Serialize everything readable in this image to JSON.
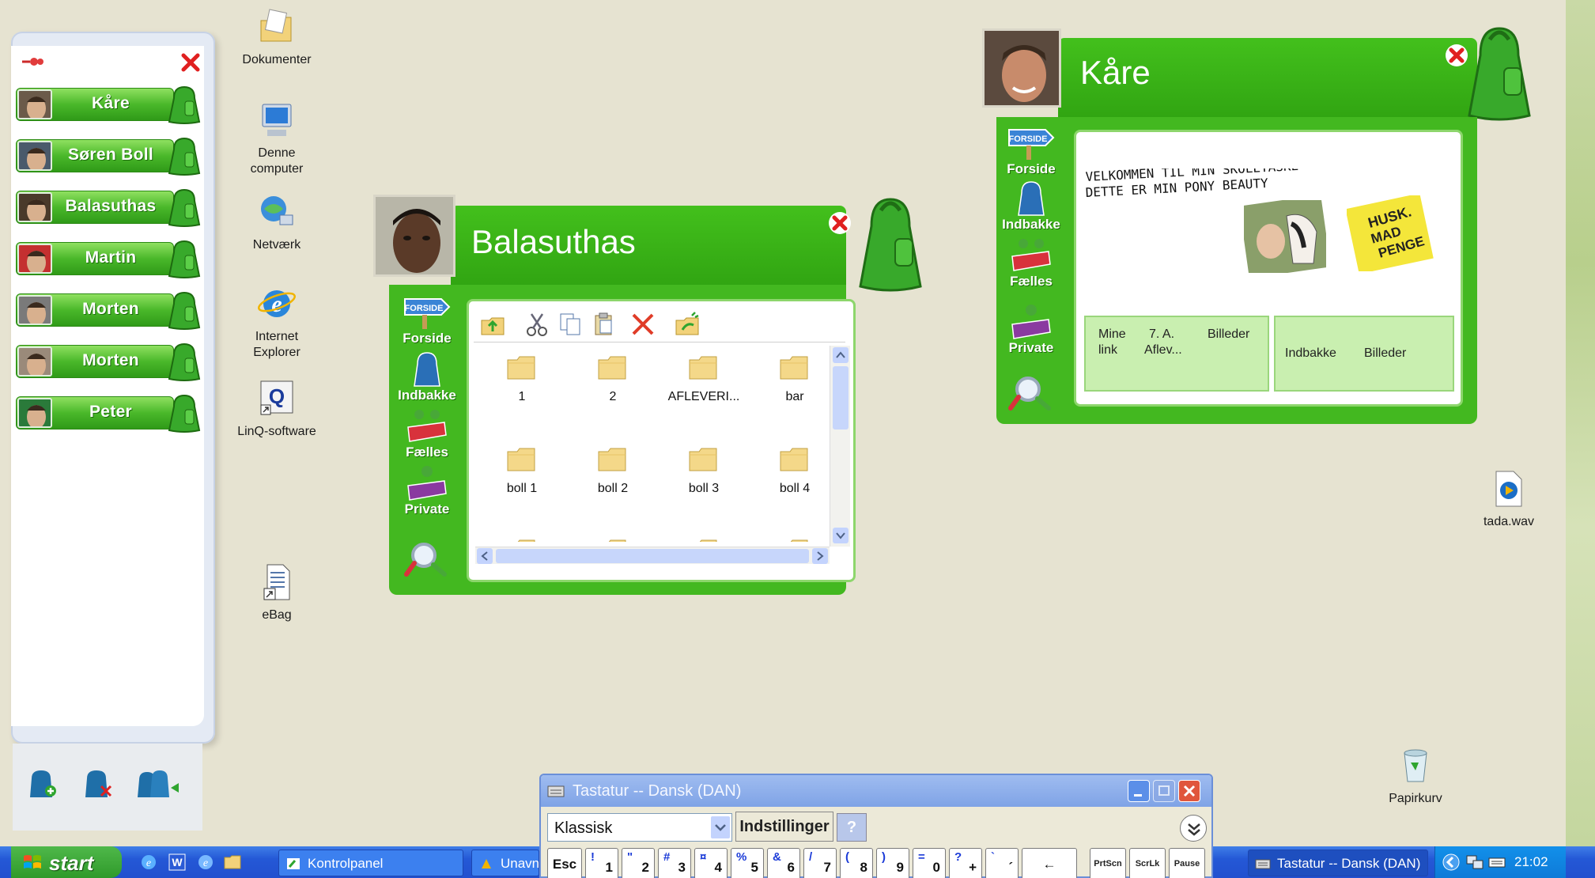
{
  "desktop": {
    "icons": [
      {
        "label": "Dokumenter",
        "icon": "folder-documents-icon"
      },
      {
        "label": "Denne computer",
        "icon": "my-computer-icon"
      },
      {
        "label": "Netværk",
        "icon": "network-icon"
      },
      {
        "label": "Internet Explorer",
        "icon": "internet-explorer-icon"
      },
      {
        "label": "LinQ-software",
        "icon": "linq-software-icon"
      },
      {
        "label": "eBag",
        "icon": "ebag-shortcut-icon"
      },
      {
        "label": "tada.wav",
        "icon": "audio-file-icon"
      },
      {
        "label": "Papirkurv",
        "icon": "recycle-bin-icon"
      }
    ]
  },
  "buddy_panel": {
    "buddies": [
      "Kåre",
      "Søren Boll",
      "Balasuthas",
      "Martin",
      "Morten",
      "Morten",
      "Peter"
    ]
  },
  "balasuthas_window": {
    "title": "Balasuthas",
    "nav": [
      "Forside",
      "Indbakke",
      "Fælles",
      "Private"
    ],
    "nav_badge": "FORSIDE",
    "files": [
      "1",
      "2",
      "AFLEVERI...",
      "bar",
      "boll 1",
      "boll 2",
      "boll 3",
      "boll 4"
    ]
  },
  "kare_window": {
    "title": "Kåre",
    "nav": [
      "Forside",
      "Indbakke",
      "Fælles",
      "Private"
    ],
    "nav_badge": "FORSIDE",
    "banner_line1": "VELKOMMEN TIL MIN SKOLETASKE",
    "banner_line2": "DETTE ER MIN PONY BEAUTY",
    "note_line1": "HUSK.",
    "note_line2": "MAD",
    "note_line3": "PENGE",
    "tab_left": {
      "a": "Mine",
      "b": "link",
      "c": "7. A.",
      "d": "Aflev...",
      "e": "Billeder"
    },
    "tab_right": {
      "a": "Indbakke",
      "b": "Billeder"
    }
  },
  "keyboard": {
    "title": "Tastatur -- Dansk (DAN)",
    "layout_value": "Klassisk",
    "settings_label": "Indstillinger",
    "help_label": "?",
    "keys": [
      {
        "top": "",
        "bottom": "Esc"
      },
      {
        "top": "!",
        "bottom": "1"
      },
      {
        "top": "\"",
        "bottom": "2"
      },
      {
        "top": "#",
        "bottom": "3"
      },
      {
        "top": "¤",
        "bottom": "4"
      },
      {
        "top": "%",
        "bottom": "5"
      },
      {
        "top": "&",
        "bottom": "6"
      },
      {
        "top": "/",
        "bottom": "7"
      },
      {
        "top": "(",
        "bottom": "8"
      },
      {
        "top": ")",
        "bottom": "9"
      },
      {
        "top": "=",
        "bottom": "0"
      },
      {
        "top": "?",
        "bottom": "+"
      },
      {
        "top": "`",
        "bottom": "´"
      },
      {
        "top": "",
        "bottom": "←"
      }
    ],
    "special_keys": [
      "PrtScn",
      "ScrLk",
      "Pause"
    ]
  },
  "taskbar": {
    "start_label": "start",
    "tasks": [
      "Kontrolpanel",
      "Unavn",
      "Tastatur -- Dansk (DAN)"
    ],
    "clock": "21:02"
  },
  "colors": {
    "green": "#43b820",
    "xp_blue": "#2458d6",
    "close_red": "#e02020"
  }
}
